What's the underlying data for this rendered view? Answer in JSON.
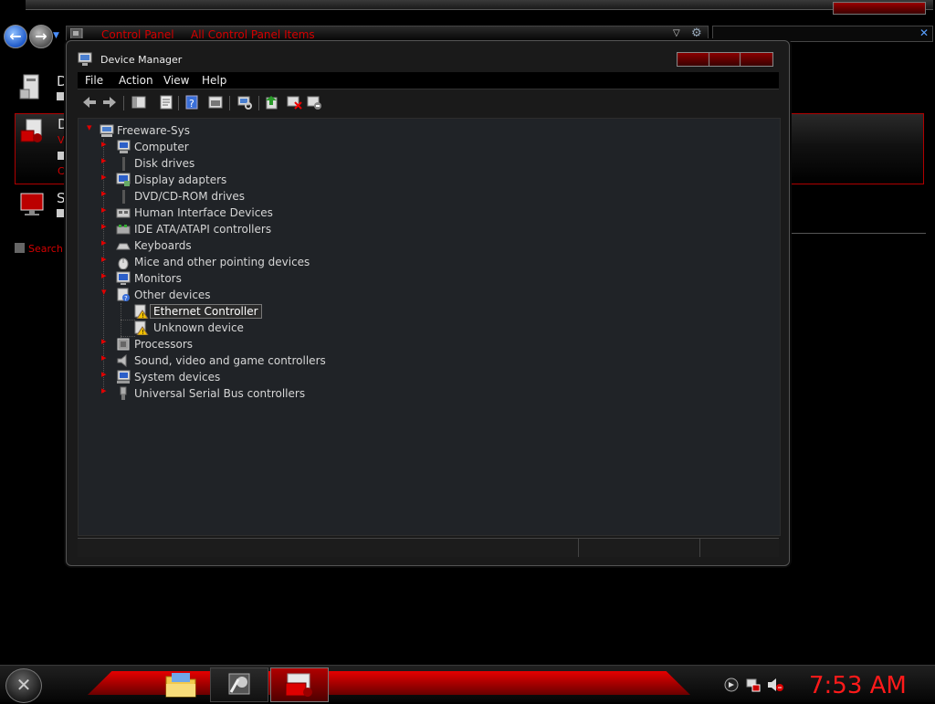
{
  "control_panel": {
    "breadcrumbs": [
      "Control Panel",
      "All Control Panel Items"
    ],
    "search_label": "Search",
    "items": [
      {
        "letter": "D",
        "icon": "devices-printers-icon"
      },
      {
        "letter": "D",
        "sub_text": "Vi",
        "sub_text2": "Ci",
        "icon": "device-manager-icon"
      },
      {
        "letter": "S",
        "icon": "system-monitor-icon"
      }
    ]
  },
  "device_manager": {
    "title": "Device Manager",
    "menu": [
      "File",
      "Action",
      "View",
      "Help"
    ],
    "toolbar": [
      "back-icon",
      "forward-icon",
      "show-hide-tree-icon",
      "properties-icon",
      "help-icon",
      "view-icon",
      "scan-hardware-icon",
      "update-driver-icon",
      "uninstall-icon",
      "disable-device-icon"
    ],
    "tree": {
      "root": "Freeware-Sys",
      "categories": [
        {
          "label": "Computer",
          "icon": "computer-icon"
        },
        {
          "label": "Disk drives",
          "icon": "disk-drive-icon"
        },
        {
          "label": "Display adapters",
          "icon": "display-adapter-icon"
        },
        {
          "label": "DVD/CD-ROM drives",
          "icon": "dvd-drive-icon"
        },
        {
          "label": "Human Interface Devices",
          "icon": "hid-icon"
        },
        {
          "label": "IDE ATA/ATAPI controllers",
          "icon": "ide-controller-icon"
        },
        {
          "label": "Keyboards",
          "icon": "keyboard-icon"
        },
        {
          "label": "Mice and other pointing devices",
          "icon": "mouse-icon"
        },
        {
          "label": "Monitors",
          "icon": "monitor-icon"
        },
        {
          "label": "Other devices",
          "icon": "other-devices-icon",
          "expanded": true,
          "children": [
            {
              "label": "Ethernet Controller",
              "icon": "warning-device-icon",
              "selected": true
            },
            {
              "label": "Unknown device",
              "icon": "warning-device-icon"
            }
          ]
        },
        {
          "label": "Processors",
          "icon": "processor-icon"
        },
        {
          "label": "Sound, video and game controllers",
          "icon": "speaker-icon"
        },
        {
          "label": "System devices",
          "icon": "system-devices-icon"
        },
        {
          "label": "Universal Serial Bus controllers",
          "icon": "usb-icon"
        }
      ]
    }
  },
  "taskbar": {
    "clock": "7:53 AM",
    "tasks": [
      "explorer-folder-icon",
      "control-panel-icon",
      "device-manager-icon"
    ],
    "tray": [
      "notification-icon",
      "network-icon",
      "volume-muted-icon"
    ]
  },
  "colors": {
    "accent": "#d40000",
    "clock": "#ff1a1a",
    "tree_bg": "#202327"
  }
}
